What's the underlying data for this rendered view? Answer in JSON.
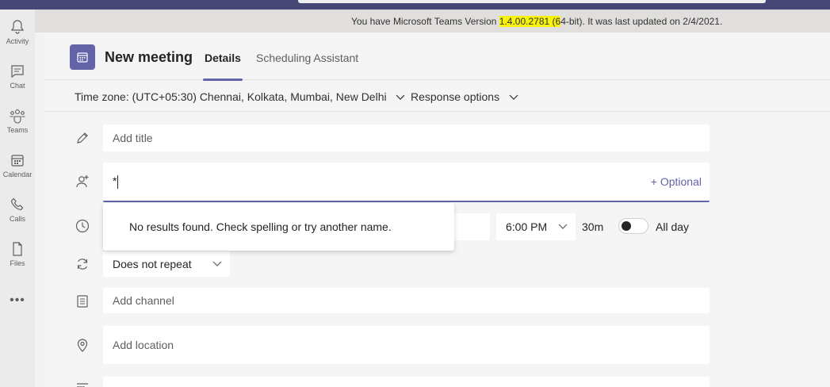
{
  "rail": {
    "items": [
      {
        "label": "Activity",
        "icon": "bell-icon"
      },
      {
        "label": "Chat",
        "icon": "chat-icon"
      },
      {
        "label": "Teams",
        "icon": "teams-icon"
      },
      {
        "label": "Calendar",
        "icon": "calendar-icon"
      },
      {
        "label": "Calls",
        "icon": "phone-icon"
      },
      {
        "label": "Files",
        "icon": "file-icon"
      }
    ],
    "more": "•••"
  },
  "banner": {
    "prefix": "You have Microsoft Teams Version ",
    "version": "1.4.00.2781 (6",
    "suffix": "4-bit). It was last updated on 2/4/2021."
  },
  "header": {
    "title": "New meeting",
    "tabs": [
      {
        "label": "Details",
        "active": true
      },
      {
        "label": "Scheduling Assistant",
        "active": false
      }
    ]
  },
  "options": {
    "timezone": "Time zone: (UTC+05:30) Chennai, Kolkata, Mumbai, New Delhi",
    "response": "Response options"
  },
  "form": {
    "title_placeholder": "Add title",
    "attendees_value": "*",
    "optional_label": "+ Optional",
    "no_results": "No results found. Check spelling or try another name.",
    "end_time": "6:00 PM",
    "duration": "30m",
    "all_day": "All day",
    "repeat": "Does not repeat",
    "channel_placeholder": "Add channel",
    "location_placeholder": "Add location"
  },
  "colors": {
    "accent": "#6264a7",
    "topbar": "#464775",
    "highlight": "#f7f30a"
  }
}
